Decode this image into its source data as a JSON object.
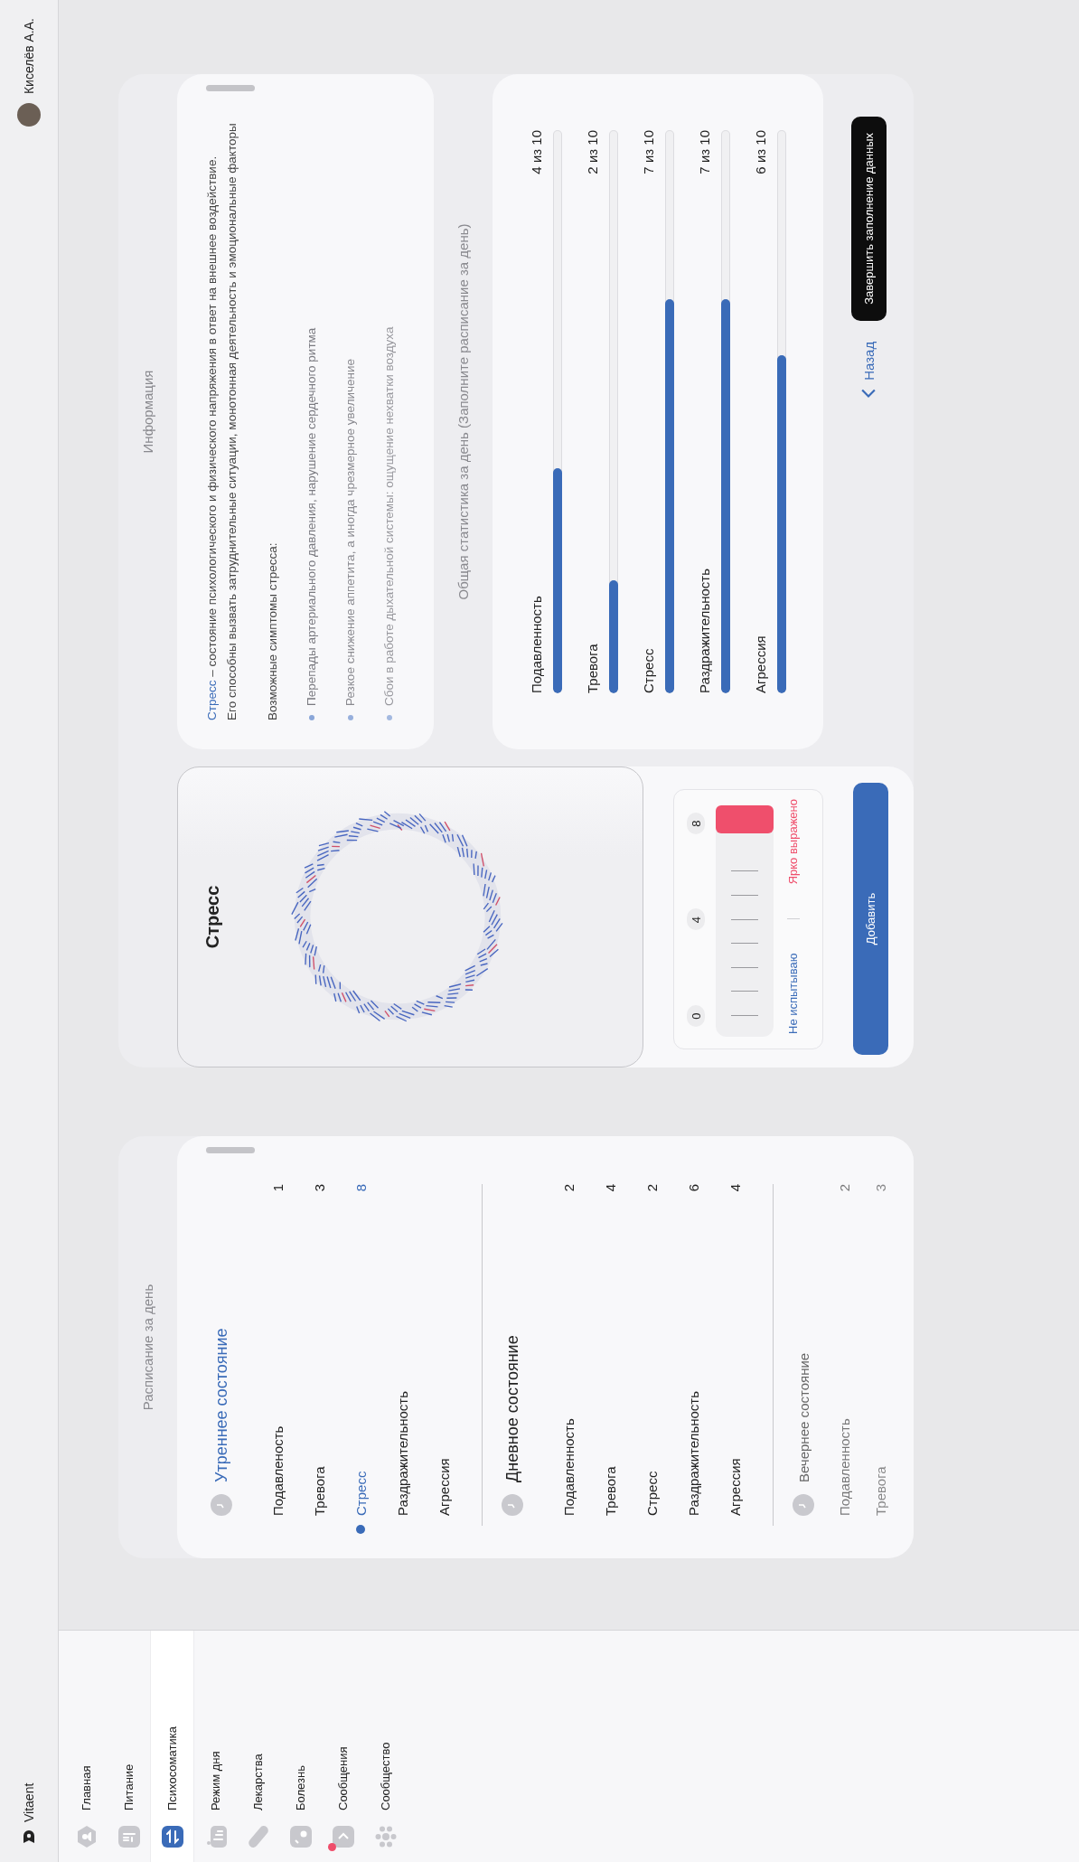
{
  "topbar": {
    "brand": "Vitaent",
    "user": "Киселёв А.А."
  },
  "sidebar": {
    "items": [
      {
        "label": "Главная",
        "selected": false,
        "unread": false
      },
      {
        "label": "Питание",
        "selected": false,
        "unread": false
      },
      {
        "label": "Психосоматика",
        "selected": true,
        "unread": false
      },
      {
        "label": "Режим дня",
        "selected": false,
        "unread": false
      },
      {
        "label": "Лекарства",
        "selected": false,
        "unread": false
      },
      {
        "label": "Болезнь",
        "selected": false,
        "unread": false
      },
      {
        "label": "Сообщения",
        "selected": false,
        "unread": true
      },
      {
        "label": "Сообщество",
        "selected": false,
        "unread": false
      }
    ]
  },
  "schedule": {
    "title": "Расписание за день",
    "groups": [
      {
        "title": "Утреннее состояние",
        "current": true,
        "disabled": false,
        "items": [
          {
            "label": "Подавленость",
            "value": "1",
            "selected": false
          },
          {
            "label": "Тревога",
            "value": "3",
            "selected": false
          },
          {
            "label": "Стресс",
            "value": "8",
            "selected": true
          },
          {
            "label": "Раздражительность",
            "value": "",
            "selected": false
          },
          {
            "label": "Агрессия",
            "value": "",
            "selected": false
          }
        ]
      },
      {
        "title": "Дневное состояние",
        "current": false,
        "disabled": false,
        "items": [
          {
            "label": "Подавленность",
            "value": "2",
            "selected": false
          },
          {
            "label": "Тревога",
            "value": "4",
            "selected": false
          },
          {
            "label": "Стресс",
            "value": "2",
            "selected": false
          },
          {
            "label": "Раздражительность",
            "value": "6",
            "selected": false
          },
          {
            "label": "Агрессия",
            "value": "4",
            "selected": false
          }
        ]
      },
      {
        "title": "Вечернее состояние",
        "current": false,
        "disabled": true,
        "items": [
          {
            "label": "Подавленность",
            "value": "2",
            "selected": false
          },
          {
            "label": "Тревога",
            "value": "3",
            "selected": false
          }
        ]
      }
    ]
  },
  "rating": {
    "title": "Стресс",
    "ticks": [
      "0",
      "4",
      "8"
    ],
    "level": 1,
    "min_label": "Не испытываю",
    "max_label": "Ярко выражено",
    "add_button": "Добавить"
  },
  "info": {
    "title": "Информация",
    "term": "Стресс",
    "definition": "– состояние психологического и физического напряжения в ответ на внешнее воздействие.",
    "note": "Его способны вызвать затруднительные ситуации, монотонная деятельность и эмоциональные факторы",
    "symptoms_title": "Возможные симптомы стресса:",
    "symptoms": [
      "Перепады артериального давления, нарушение сердечного ритма",
      "Резкое снижение аппетита, а иногда чрезмерное увеличение",
      "Сбои в работе дыхательной системы: ощущение нехватки воздуха"
    ]
  },
  "stats": {
    "title": "Общая статистика за день (Заполните расписание за день)",
    "rows": [
      {
        "label": "Подавленность",
        "reading": "4 из 10",
        "level": 0.4
      },
      {
        "label": "Тревога",
        "reading": "2 из 10",
        "level": 0.2
      },
      {
        "label": "Стресс",
        "reading": "7 из 10",
        "level": 0.7
      },
      {
        "label": "Раздражительность",
        "reading": "7 из 10",
        "level": 0.7
      },
      {
        "label": "Агрессия",
        "reading": "6 из 10",
        "level": 0.6
      }
    ]
  },
  "actions": {
    "back": "Назад",
    "finish": "Завершить заполнение данных"
  }
}
